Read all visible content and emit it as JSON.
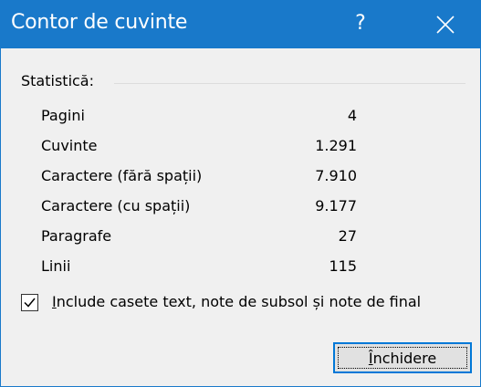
{
  "window": {
    "title": "Contor de cuvinte",
    "help_glyph": "?",
    "titlebar_color": "#1979ca"
  },
  "statistics": {
    "heading": "Statistică:",
    "rows": [
      {
        "label": "Pagini",
        "value": "4"
      },
      {
        "label": "Cuvinte",
        "value": "1.291"
      },
      {
        "label": "Caractere (fără spații)",
        "value": "7.910"
      },
      {
        "label": "Caractere (cu spații)",
        "value": "9.177"
      },
      {
        "label": "Paragrafe",
        "value": "27"
      },
      {
        "label": "Linii",
        "value": "115"
      }
    ]
  },
  "include_option": {
    "accel_char": "I",
    "label_rest": "nclude casete text, note de subsol și note de final",
    "checked": true
  },
  "close_button": {
    "accel_char": "Î",
    "label_rest": "nchidere"
  }
}
